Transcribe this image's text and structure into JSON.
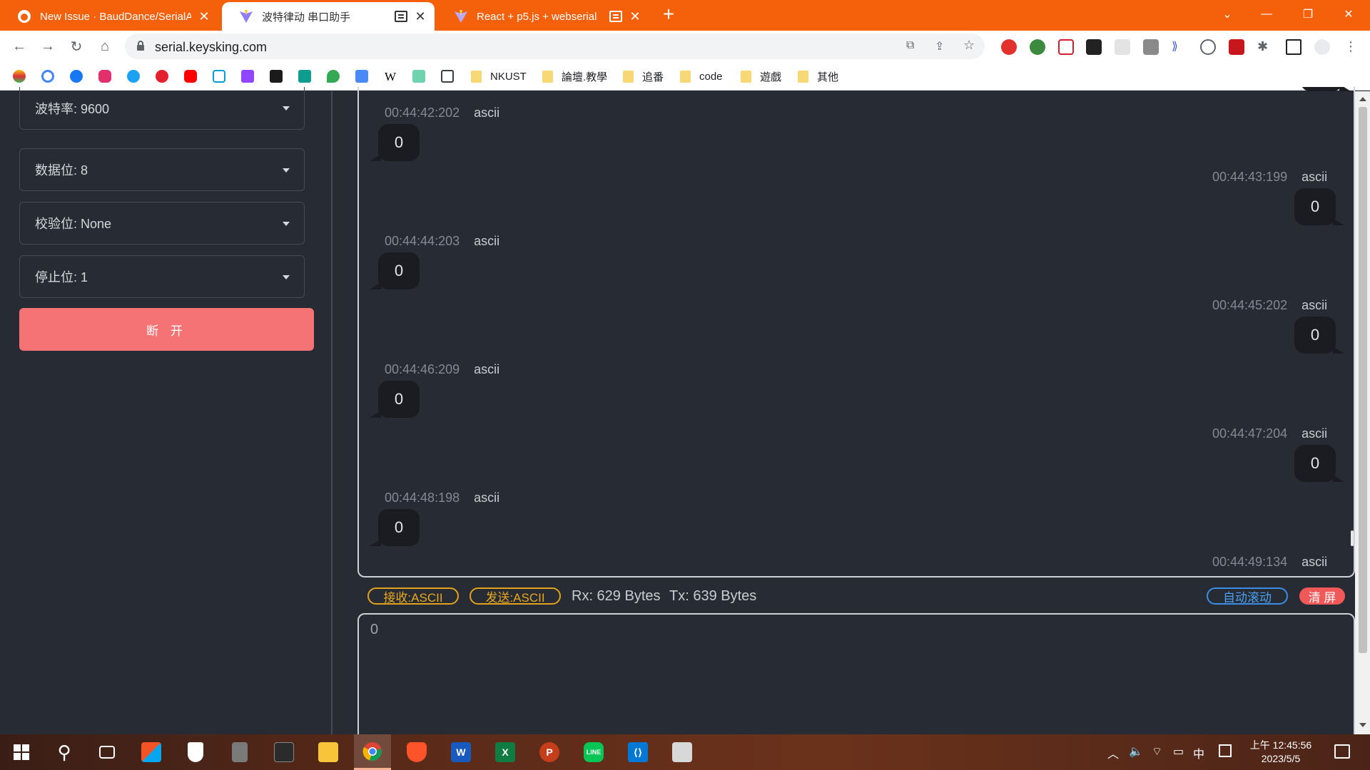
{
  "browser": {
    "tabs": [
      {
        "title": "New Issue · BaudDance/SerialA",
        "active": false
      },
      {
        "title": "波特律动 串口助手",
        "active": true
      },
      {
        "title": "React + p5.js + webserial",
        "active": false
      }
    ],
    "url": "serial.keysking.com",
    "bookmark_folders": [
      "NKUST",
      "論壇.教學",
      "追番",
      "code",
      "遊戲",
      "其他"
    ]
  },
  "sidebar": {
    "baud_rate": "波特率: 9600",
    "data_bits": "数据位: 8",
    "parity": "校验位: None",
    "stop_bits": "停止位: 1",
    "disconnect_label": "断 开"
  },
  "log": {
    "messages": [
      {
        "time": "00:44:42:202",
        "format": "ascii",
        "content": "0",
        "side": "left"
      },
      {
        "time": "00:44:43:199",
        "format": "ascii",
        "content": "0",
        "side": "right"
      },
      {
        "time": "00:44:44:203",
        "format": "ascii",
        "content": "0",
        "side": "left"
      },
      {
        "time": "00:44:45:202",
        "format": "ascii",
        "content": "0",
        "side": "right"
      },
      {
        "time": "00:44:46:209",
        "format": "ascii",
        "content": "0",
        "side": "left"
      },
      {
        "time": "00:44:47:204",
        "format": "ascii",
        "content": "0",
        "side": "right"
      },
      {
        "time": "00:44:48:198",
        "format": "ascii",
        "content": "0",
        "side": "left"
      },
      {
        "time": "00:44:49:134",
        "format": "ascii",
        "content": "",
        "side": "right"
      }
    ]
  },
  "status": {
    "rx_mode": "接收:ASCII",
    "tx_mode": "发送:ASCII",
    "rx_bytes": "Rx: 629 Bytes",
    "tx_bytes": "Tx: 639 Bytes",
    "auto_scroll": "自动滚动",
    "clear": "清 屏"
  },
  "input": {
    "value": "0"
  },
  "taskbar": {
    "time": "上午 12:45:56",
    "date": "2023/5/5",
    "ime": "中"
  },
  "colors": {
    "tab_strip": "#f5600b",
    "page_bg": "#272b33",
    "disconnect": "#f57374",
    "bubble": "#1a1c21"
  }
}
